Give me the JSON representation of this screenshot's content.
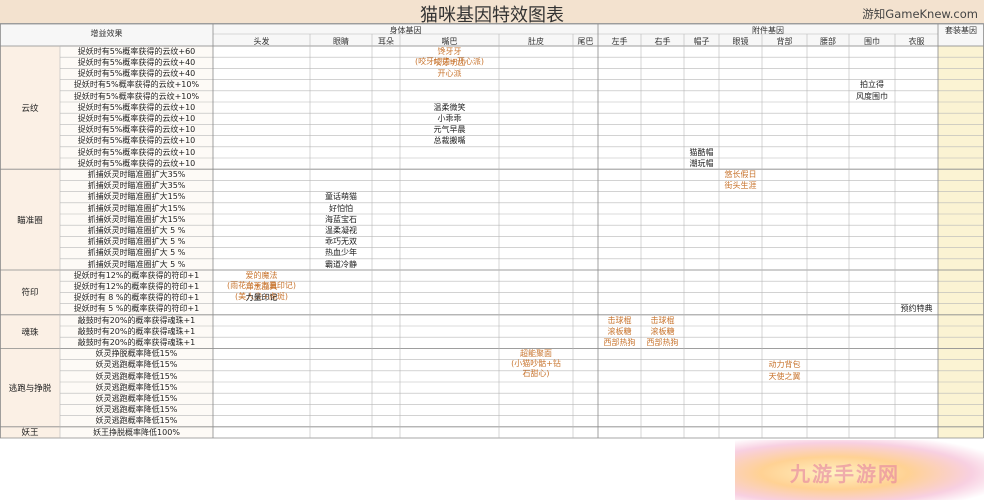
{
  "title": "猫咪基因特效图表",
  "site": "游知GameKnew.com",
  "header": {
    "effect": "增益效果",
    "body_gene": "身体基因",
    "accessory_gene": "附件基因",
    "set_gene": "套装基因",
    "columns": [
      "头发",
      "眼睛",
      "耳朵",
      "嘴巴",
      "肚皮",
      "尾巴",
      "左手",
      "右手",
      "帽子",
      "眼镜",
      "背部",
      "腰部",
      "围巾",
      "衣服"
    ]
  },
  "categories": [
    {
      "name": "云纹",
      "rows": [
        {
          "effect": "捉妖时有5%概率获得的云纹+60",
          "cells": [
            {
              "col": 3,
              "lines": [
                "馋牙牙",
                "(咬牙切齿+开心派)"
              ],
              "color": "orange"
            }
          ]
        },
        {
          "effect": "捉妖时有5%概率获得的云纹+40",
          "cells": [
            {
              "col": 3,
              "lines": [
                "咬牙切齿"
              ],
              "color": "orange"
            }
          ]
        },
        {
          "effect": "捉妖时有5%概率获得的云纹+40",
          "cells": [
            {
              "col": 3,
              "lines": [
                "开心派"
              ],
              "color": "orange"
            }
          ]
        },
        {
          "effect": "捉妖时有5%概率获得的云纹+10%",
          "cells": [
            {
              "col": 12,
              "lines": [
                "拍立得"
              ]
            }
          ]
        },
        {
          "effect": "捉妖时有5%概率获得的云纹+10%",
          "cells": [
            {
              "col": 12,
              "lines": [
                "风度围巾"
              ]
            }
          ]
        },
        {
          "effect": "捉妖时有5%概率获得的云纹+10",
          "cells": [
            {
              "col": 3,
              "lines": [
                "温柔微笑"
              ]
            }
          ]
        },
        {
          "effect": "捉妖时有5%概率获得的云纹+10",
          "cells": [
            {
              "col": 3,
              "lines": [
                "小乖乖"
              ]
            }
          ]
        },
        {
          "effect": "捉妖时有5%概率获得的云纹+10",
          "cells": [
            {
              "col": 3,
              "lines": [
                "元气早晨"
              ]
            }
          ]
        },
        {
          "effect": "捉妖时有5%概率获得的云纹+10",
          "cells": [
            {
              "col": 3,
              "lines": [
                "总裁搬嘴"
              ]
            }
          ]
        },
        {
          "effect": "捉妖时有5%概率获得的云纹+10",
          "cells": [
            {
              "col": 8,
              "lines": [
                "猫酷帽"
              ]
            }
          ]
        },
        {
          "effect": "捉妖时有5%概率获得的云纹+10",
          "cells": [
            {
              "col": 8,
              "lines": [
                "潮玩帽"
              ]
            }
          ]
        }
      ]
    },
    {
      "name": "瞄准圈",
      "rows": [
        {
          "effect": "抓捕妖灵时瞄准圈扩大35%",
          "cells": [
            {
              "col": 9,
              "lines": [
                "悠长假日"
              ],
              "color": "orange"
            }
          ]
        },
        {
          "effect": "抓捕妖灵时瞄准圈扩大35%",
          "cells": [
            {
              "col": 9,
              "lines": [
                "街头生涯"
              ],
              "color": "orange"
            }
          ]
        },
        {
          "effect": "抓捕妖灵时瞄准圈扩大15%",
          "cells": [
            {
              "col": 1,
              "lines": [
                "童话萌猫"
              ]
            }
          ]
        },
        {
          "effect": "抓捕妖灵时瞄准圈扩大15%",
          "cells": [
            {
              "col": 1,
              "lines": [
                "好怕怕"
              ]
            }
          ]
        },
        {
          "effect": "抓捕妖灵时瞄准圈扩大15%",
          "cells": [
            {
              "col": 1,
              "lines": [
                "海蓝宝石"
              ]
            }
          ]
        },
        {
          "effect": "抓捕妖灵时瞄准圈扩大 5 %",
          "cells": [
            {
              "col": 1,
              "lines": [
                "温柔凝视"
              ]
            }
          ]
        },
        {
          "effect": "抓捕妖灵时瞄准圈扩大 5 %",
          "cells": [
            {
              "col": 1,
              "lines": [
                "乖巧无双"
              ]
            }
          ]
        },
        {
          "effect": "抓捕妖灵时瞄准圈扩大 5 %",
          "cells": [
            {
              "col": 1,
              "lines": [
                "热血少年"
              ]
            }
          ]
        },
        {
          "effect": "抓捕妖灵时瞄准圈扩大 5 %",
          "cells": [
            {
              "col": 1,
              "lines": [
                "霸道冷静"
              ]
            }
          ]
        }
      ]
    },
    {
      "name": "符印",
      "rows": [
        {
          "effect": "捉妖时有12%的概率获得的符印+1",
          "cells": [
            {
              "col": 0,
              "lines": [
                "爱的魔法",
                "(雨花台+力量印记)"
              ],
              "color": "orange"
            }
          ]
        },
        {
          "effect": "捉妖时有12%的概率获得的符印+1",
          "cells": [
            {
              "col": 0,
              "lines": [
                "洋葱面具",
                "(美人尖+虎斑)"
              ],
              "color": "orange"
            }
          ]
        },
        {
          "effect": "捉妖时有 8 %的概率获得的符印+1",
          "cells": [
            {
              "col": 0,
              "lines": [
                "力量印记"
              ]
            }
          ]
        },
        {
          "effect": "捉妖时有 5 %的概率获得的符印+1",
          "cells": [
            {
              "col": 13,
              "lines": [
                "预约特典"
              ]
            }
          ]
        }
      ]
    },
    {
      "name": "魂珠",
      "rows": [
        {
          "effect": "敲鼓时有20%的概率获得魂珠+1",
          "cells": [
            {
              "col": 6,
              "lines": [
                "击球棍"
              ],
              "color": "orange"
            },
            {
              "col": 7,
              "lines": [
                "击球棍"
              ],
              "color": "orange"
            }
          ]
        },
        {
          "effect": "敲鼓时有20%的概率获得魂珠+1",
          "cells": [
            {
              "col": 6,
              "lines": [
                "滚板糖"
              ],
              "color": "orange"
            },
            {
              "col": 7,
              "lines": [
                "滚板糖"
              ],
              "color": "orange"
            }
          ]
        },
        {
          "effect": "敲鼓时有20%的概率获得魂珠+1",
          "cells": [
            {
              "col": 6,
              "lines": [
                "西部热狗"
              ],
              "color": "orange"
            },
            {
              "col": 7,
              "lines": [
                "西部热狗"
              ],
              "color": "orange"
            }
          ]
        }
      ]
    },
    {
      "name": "逃跑与挣脱",
      "rows": [
        {
          "effect": "妖灵挣脱概率降低15%",
          "cells": [
            {
              "col": 4,
              "lines": [
                "超能聚面",
                "(小猫吵骷+钻",
                "石甜心)"
              ],
              "color": "orange"
            }
          ]
        },
        {
          "effect": "妖灵逃跑概率降低15%",
          "cells": [
            {
              "col": 10,
              "lines": [
                "动力背包"
              ],
              "color": "orange"
            }
          ]
        },
        {
          "effect": "妖灵逃跑概率降低15%",
          "cells": [
            {
              "col": 10,
              "lines": [
                "天使之翼"
              ],
              "color": "orange"
            }
          ]
        },
        {
          "effect": "妖灵逃跑概率降低15%",
          "cells": []
        },
        {
          "effect": "妖灵逃跑概率降低15%",
          "cells": []
        },
        {
          "effect": "妖灵逃跑概率降低15%",
          "cells": []
        },
        {
          "effect": "妖灵逃跑概率降低15%",
          "cells": []
        }
      ]
    },
    {
      "name": "妖王",
      "rows": [
        {
          "effect": "妖王挣脱概率降低100%",
          "cells": []
        }
      ]
    }
  ],
  "watermark": "九游手游网",
  "colors": {
    "header_bg": "#f3e2cf",
    "category_bg": "#fbf0e5",
    "orange_text": "#c8742e",
    "grid_line": "#b8b8b8",
    "set_gene_bg": "#fbf3d3"
  }
}
